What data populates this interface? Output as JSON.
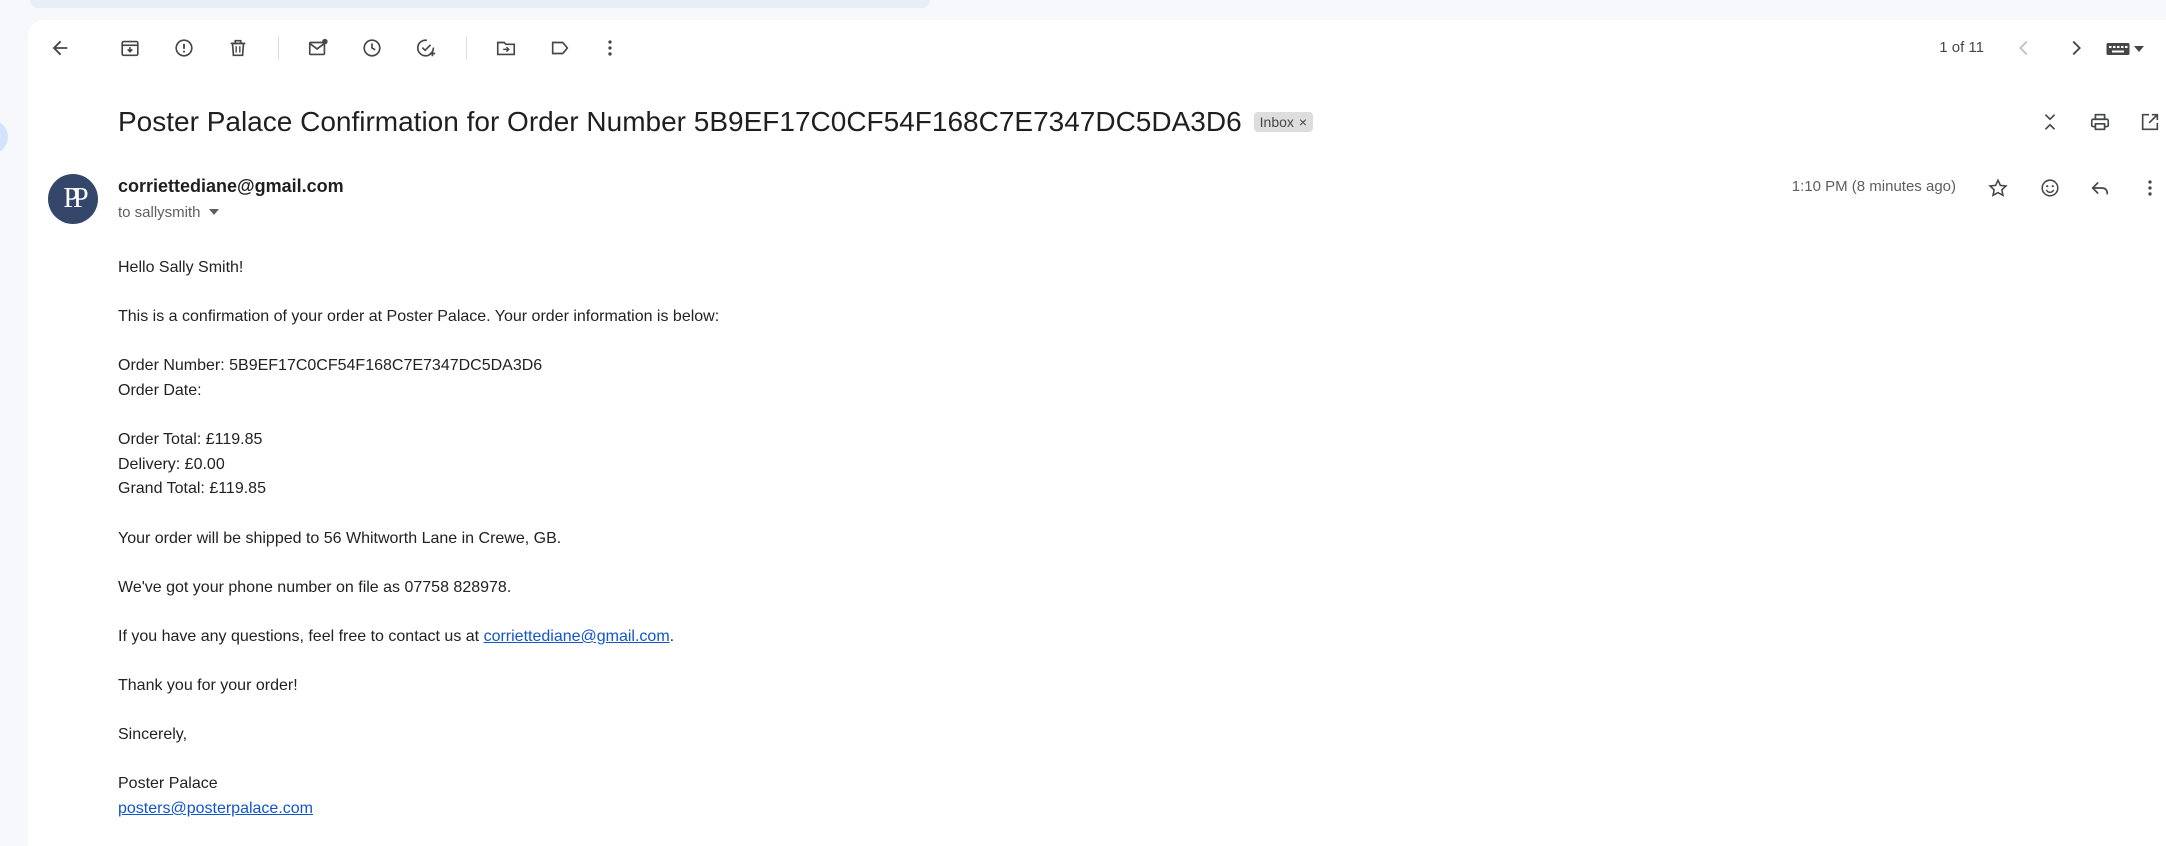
{
  "toolbar": {
    "icons": [
      "back-icon",
      "archive-icon",
      "report-spam-icon",
      "delete-icon",
      "mark-unread-icon",
      "snooze-icon",
      "add-task-icon",
      "move-to-icon",
      "label-icon",
      "more-vert-icon"
    ],
    "pager_text": "1 of 11"
  },
  "email": {
    "subject": "Poster Palace Confirmation for Order Number 5B9EF17C0CF54F168C7E7347DC5DA3D6",
    "label_chip": "Inbox",
    "label_chip_close": "×",
    "sender": "corriettediane@gmail.com",
    "avatar_text": "PP",
    "recipient": "to sallysmith",
    "time": "1:10 PM (8 minutes ago)",
    "body": {
      "greeting": "Hello Sally Smith!",
      "intro": "This is a confirmation of your order at Poster Palace. Your order information is below:",
      "order_number": "Order Number: 5B9EF17C0CF54F168C7E7347DC5DA3D6",
      "order_date": "Order Date:",
      "order_total": "Order Total: £119.85",
      "delivery": "Delivery: £0.00",
      "grand_total": "Grand Total: £119.85",
      "shipping": "Your order will be shipped to 56 Whitworth Lane in Crewe, GB.",
      "phone": "We've got your phone number on file as 07758 828978.",
      "questions_prefix": "If you have any questions, feel free to contact us at ",
      "questions_link": "corriettediane@gmail.com",
      "questions_suffix": ".",
      "thanks": "Thank you for your order!",
      "closing": "Sincerely,",
      "signature_name": "Poster Palace",
      "signature_email": "posters@posterpalace.com"
    }
  },
  "colors": {
    "avatar_bg": "#35466b",
    "link": "#1155cc",
    "page_bg": "#f6f8fc"
  }
}
